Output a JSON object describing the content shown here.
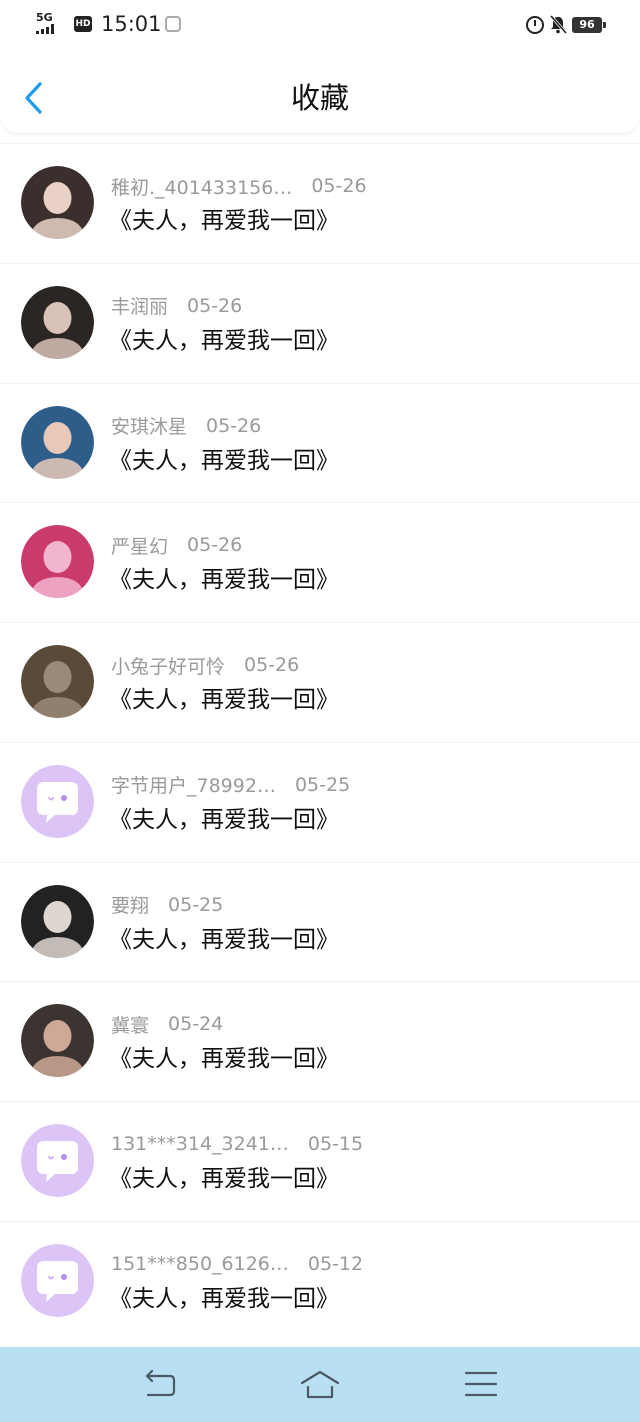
{
  "status_bar": {
    "network": "5G",
    "hd": "HD",
    "time": "15:01",
    "battery": "96"
  },
  "header": {
    "title": "收藏",
    "back_icon": "chevron-left-icon"
  },
  "colors": {
    "accent": "#1a9bf0",
    "nav_bar_bg": "#b9dff3",
    "default_avatar_bg": "#dcc4f7",
    "meta_text": "#9a9a9a"
  },
  "items": [
    {
      "username": "稚初._401433156…",
      "date": "05-26",
      "message": "《夫人，再爱我一回》",
      "avatar": "photo-avatar"
    },
    {
      "username": "丰润丽",
      "date": "05-26",
      "message": "《夫人，再爱我一回》",
      "avatar": "photo-avatar"
    },
    {
      "username": "安琪沐星",
      "date": "05-26",
      "message": "《夫人，再爱我一回》",
      "avatar": "photo-avatar"
    },
    {
      "username": "严星幻",
      "date": "05-26",
      "message": "《夫人，再爱我一回》",
      "avatar": "photo-avatar"
    },
    {
      "username": "小兔子好可怜",
      "date": "05-26",
      "message": "《夫人，再爱我一回》",
      "avatar": "photo-avatar"
    },
    {
      "username": "字节用户_78992…",
      "date": "05-25",
      "message": "《夫人，再爱我一回》",
      "avatar": "default-chat-avatar"
    },
    {
      "username": "要翔",
      "date": "05-25",
      "message": "《夫人，再爱我一回》",
      "avatar": "photo-avatar"
    },
    {
      "username": "冀寰",
      "date": "05-24",
      "message": "《夫人，再爱我一回》",
      "avatar": "photo-avatar"
    },
    {
      "username": "131***314_3241…",
      "date": "05-15",
      "message": "《夫人，再爱我一回》",
      "avatar": "default-chat-avatar"
    },
    {
      "username": "151***850_6126…",
      "date": "05-12",
      "message": "《夫人，再爱我一回》",
      "avatar": "default-chat-avatar"
    }
  ],
  "nav_bar": {
    "back_icon": "nav-back-icon",
    "home_icon": "nav-home-icon",
    "menu_icon": "nav-menu-icon"
  }
}
